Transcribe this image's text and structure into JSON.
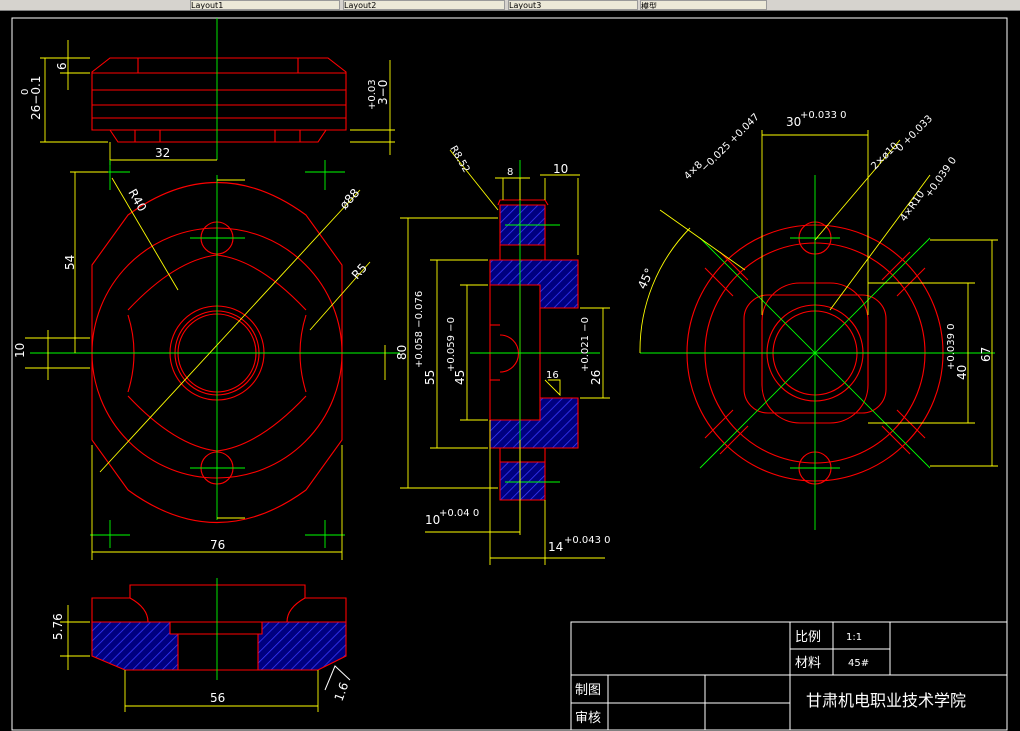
{
  "toolbar": {
    "tabs": [
      "Layout1",
      "Layout2",
      "Layout3",
      "模型"
    ]
  },
  "view_top": {
    "dim_6": "6",
    "dim_26": "26−0.1",
    "dim_26_upper": "0",
    "dim_3": "3−0",
    "dim_3_upper": "+0.03",
    "dim_32": "32"
  },
  "view_front": {
    "r40": "R40",
    "d88": "ø88",
    "r5": "R5",
    "dim_54": "54",
    "dim_10": "10",
    "dim_76": "76"
  },
  "view_section": {
    "r8": "R8.52",
    "dim_8": "8",
    "dim_10": "10",
    "dim_80": "80",
    "dim_55": "55",
    "dim_55_tol": "+0.058 −0.076",
    "dim_45": "45",
    "dim_45_tol": "+0.059 −0",
    "dim_26": "26",
    "dim_26_tol": "+0.021 −0",
    "rough": "16",
    "dim_10b": "10",
    "dim_10b_tol": "+0.04 0",
    "dim_14": "14",
    "dim_14_tol": "+0.043 0"
  },
  "view_right": {
    "dim_30": "30",
    "dim_30_tol": "+0.033 0",
    "dim_4x8": "4×8",
    "dim_4x8_tol": "−0.025 +0.047",
    "dim_2x10": "2×ø10",
    "dim_2x10_tol": "0 +0.033",
    "dim_4xr10": "4×R10",
    "dim_4xr10_tol": "+0.039 0",
    "angle": "45°",
    "dim_40": "40",
    "dim_40_tol": "+0.039 0",
    "dim_67": "67"
  },
  "view_bottom": {
    "dim_576": "5.76",
    "dim_56": "56",
    "rough": "1.6"
  },
  "title_block": {
    "scale_label": "比例",
    "scale_value": "1:1",
    "material_label": "材料",
    "material_value": "45#",
    "drawn_label": "制图",
    "checked_label": "审核",
    "school": "甘肃机电职业技术学院"
  }
}
